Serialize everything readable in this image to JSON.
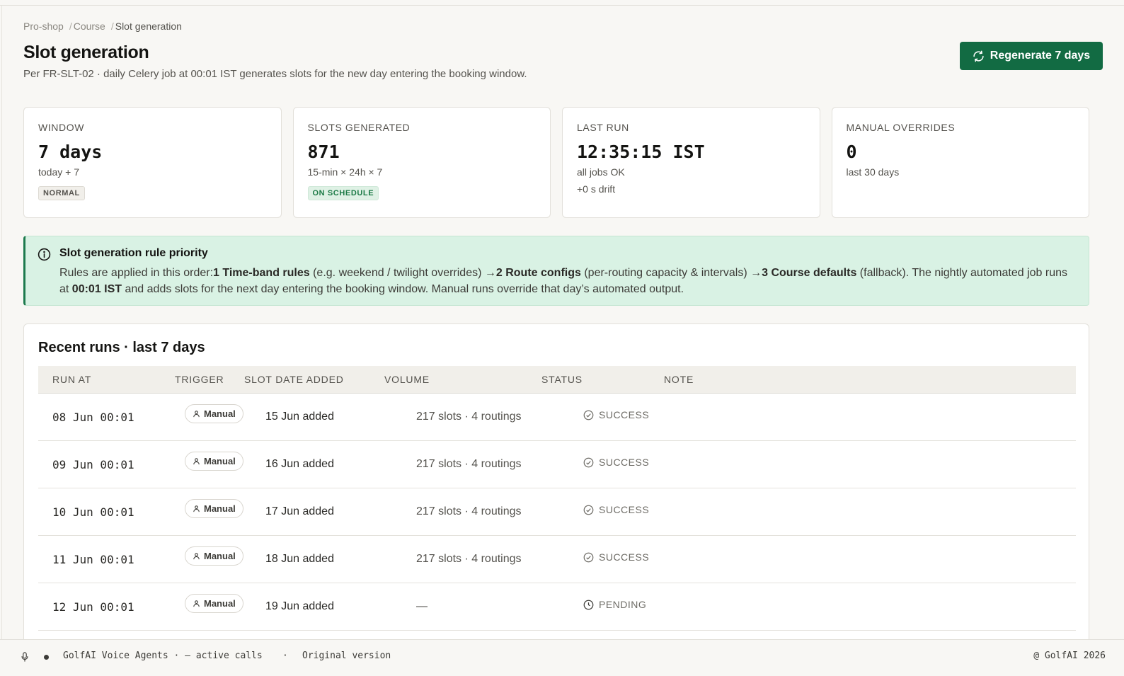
{
  "breadcrumb": {
    "items": [
      "Pro-shop",
      "Course",
      "Slot generation"
    ]
  },
  "header": {
    "title": "Slot generation",
    "subtitle": "Per FR-SLT-02 · daily Celery job at 00:01 IST generates slots for the new day entering the booking window.",
    "regen_label": "Regenerate 7 days"
  },
  "stats": [
    {
      "label": "WINDOW",
      "value": "7 days",
      "sub": "today + 7",
      "badge": "NORMAL"
    },
    {
      "label": "SLOTS GENERATED",
      "value": "871",
      "sub": "15-min × 24h × 7",
      "badge": "ON SCHEDULE"
    },
    {
      "label": "LAST RUN",
      "value": "12:35:15 IST",
      "sub": "all jobs OK",
      "sub2": "+0 s drift"
    },
    {
      "label": "MANUAL OVERRIDES",
      "value": "0",
      "sub": "last 30 days"
    }
  ],
  "callout": {
    "title": "Slot generation rule priority",
    "intro": "Rules are applied in this order:",
    "rule1": "1 Time-band rules",
    "rule1_desc": " (e.g. weekend / twilight overrides) →",
    "rule2": "2 Route configs",
    "rule2_desc": " (per-routing capacity & intervals) →",
    "rule3": "3 Course defaults",
    "rule3_desc": " (fallback). The nightly automated job runs at ",
    "time": "00:01 IST",
    "outro": " and adds slots for the next day entering the booking window. Manual runs override that day’s automated output."
  },
  "runs": {
    "title": "Recent runs · last 7 days",
    "columns": [
      "RUN AT",
      "TRIGGER",
      "SLOT DATE ADDED",
      "VOLUME",
      "STATUS",
      "NOTE"
    ],
    "rows": [
      {
        "run_at": "08 Jun 00:01",
        "trigger": "Manual",
        "slot_date": "15 Jun added",
        "volume": "217 slots · 4 routings",
        "status": "SUCCESS",
        "note": ""
      },
      {
        "run_at": "09 Jun 00:01",
        "trigger": "Manual",
        "slot_date": "16 Jun added",
        "volume": "217 slots · 4 routings",
        "status": "SUCCESS",
        "note": ""
      },
      {
        "run_at": "10 Jun 00:01",
        "trigger": "Manual",
        "slot_date": "17 Jun added",
        "volume": "217 slots · 4 routings",
        "status": "SUCCESS",
        "note": ""
      },
      {
        "run_at": "11 Jun 00:01",
        "trigger": "Manual",
        "slot_date": "18 Jun added",
        "volume": "217 slots · 4 routings",
        "status": "SUCCESS",
        "note": ""
      },
      {
        "run_at": "12 Jun 00:01",
        "trigger": "Manual",
        "slot_date": "19 Jun added",
        "volume": "—",
        "status": "PENDING",
        "note": ""
      }
    ]
  },
  "footer": {
    "label": "GolfAI Voice Agents · — active calls",
    "sep": "·",
    "version": "Original version",
    "copyright": "@ GolfAI 2026"
  },
  "colors": {
    "accent": "#126b43",
    "callout_bg": "#d9f2e4",
    "success": "#1c7a46"
  }
}
